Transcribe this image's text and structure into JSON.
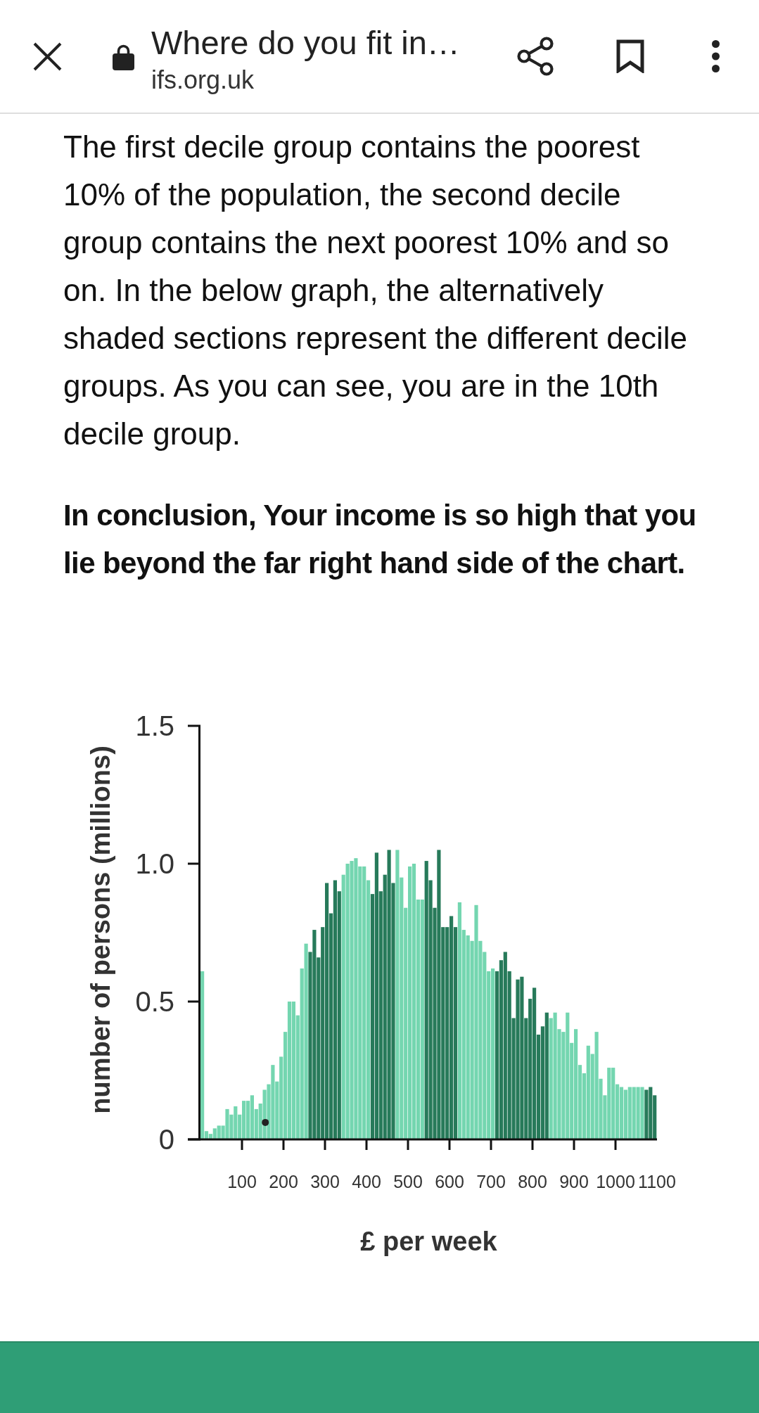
{
  "toolbar": {
    "title": "Where do you fit in…",
    "domain": "ifs.org.uk"
  },
  "article": {
    "paragraph": "The first decile group contains the poorest 10% of the population, the second decile group contains the next poorest 10% and so on. In the below graph, the alternatively shaded sections represent the different decile groups. As you can see, you are in the 10th decile group.",
    "conclusion": "In conclusion, Your income is so high that you lie beyond the far right hand side of the chart."
  },
  "chart": {
    "chart_data": {
      "type": "bar",
      "xlabel": "£ per week",
      "ylabel": "number of persons (millions)",
      "xlim": [
        0,
        1100
      ],
      "ylim": [
        0,
        1.5
      ],
      "xticks": [
        100,
        200,
        300,
        400,
        500,
        600,
        700,
        800,
        900,
        1000,
        1100
      ],
      "yticks": [
        0,
        0.5,
        {
          "value": 1,
          "label": "1.0"
        },
        1.5
      ],
      "x": [
        0,
        10,
        20,
        30,
        40,
        50,
        60,
        70,
        80,
        90,
        100,
        110,
        120,
        130,
        140,
        150,
        160,
        170,
        180,
        190,
        200,
        210,
        220,
        230,
        240,
        250,
        260,
        270,
        280,
        290,
        300,
        310,
        320,
        330,
        340,
        350,
        360,
        370,
        380,
        390,
        400,
        410,
        420,
        430,
        440,
        450,
        460,
        470,
        480,
        490,
        500,
        510,
        520,
        530,
        540,
        550,
        560,
        570,
        580,
        590,
        600,
        610,
        620,
        630,
        640,
        650,
        660,
        670,
        680,
        690,
        700,
        710,
        720,
        730,
        740,
        750,
        760,
        770,
        780,
        790,
        800,
        810,
        820,
        830,
        840,
        850,
        860,
        870,
        880,
        890,
        900,
        910,
        920,
        930,
        940,
        950,
        960,
        970,
        980,
        990,
        1000,
        1010,
        1020,
        1030,
        1040,
        1050,
        1060,
        1070,
        1080,
        1090
      ],
      "series": [
        {
          "color": "#74d6b0",
          "values": [
            0.61,
            0.03,
            0.02,
            0.04,
            0.05,
            0.05,
            0.11,
            0.09,
            0.12,
            0.09,
            0.14,
            0.14,
            0.16,
            0.11,
            0.13,
            0.18,
            0.2,
            0.27,
            0.21,
            0.3,
            0.39,
            0.5,
            0.5,
            0.45,
            0.62,
            0.71,
            null,
            null,
            null,
            null,
            null,
            null,
            null,
            null,
            0.96,
            1.0,
            1.01,
            1.02,
            0.99,
            0.99,
            0.94,
            null,
            null,
            null,
            null,
            null,
            null,
            1.05,
            0.95,
            0.84,
            0.99,
            1.0,
            0.87,
            0.87,
            null,
            null,
            null,
            null,
            null,
            null,
            null,
            null,
            0.86,
            0.76,
            0.74,
            0.72,
            0.85,
            0.72,
            0.68,
            0.61,
            0.62,
            null,
            null,
            null,
            null,
            null,
            null,
            null,
            null,
            null,
            null,
            null,
            null,
            null,
            0.44,
            0.46,
            0.4,
            0.39,
            0.46,
            0.35,
            0.4,
            0.27,
            0.24,
            0.34,
            0.31,
            0.39,
            0.22,
            0.16,
            0.26,
            0.26,
            0.2,
            0.19,
            0.18,
            0.19,
            0.19,
            0.19,
            0.19,
            null,
            null,
            null
          ]
        },
        {
          "color": "#277a5a",
          "values": [
            null,
            null,
            null,
            null,
            null,
            null,
            null,
            null,
            null,
            null,
            null,
            null,
            null,
            null,
            null,
            null,
            null,
            null,
            null,
            null,
            null,
            null,
            null,
            null,
            null,
            null,
            0.68,
            0.76,
            0.66,
            0.77,
            0.93,
            0.82,
            0.94,
            0.9,
            null,
            null,
            null,
            null,
            null,
            null,
            null,
            0.89,
            1.04,
            0.9,
            0.96,
            1.05,
            0.93,
            null,
            null,
            null,
            null,
            null,
            null,
            null,
            1.01,
            0.94,
            0.84,
            1.05,
            0.77,
            0.77,
            0.81,
            0.77,
            null,
            null,
            null,
            null,
            null,
            null,
            null,
            null,
            null,
            0.61,
            0.65,
            0.68,
            0.61,
            0.44,
            0.58,
            0.59,
            0.44,
            0.51,
            0.55,
            0.38,
            0.41,
            0.46,
            null,
            null,
            null,
            null,
            null,
            null,
            null,
            null,
            null,
            null,
            null,
            null,
            null,
            null,
            null,
            null,
            null,
            null,
            null,
            null,
            null,
            null,
            null,
            0.18,
            0.19,
            0.16
          ]
        }
      ]
    }
  }
}
